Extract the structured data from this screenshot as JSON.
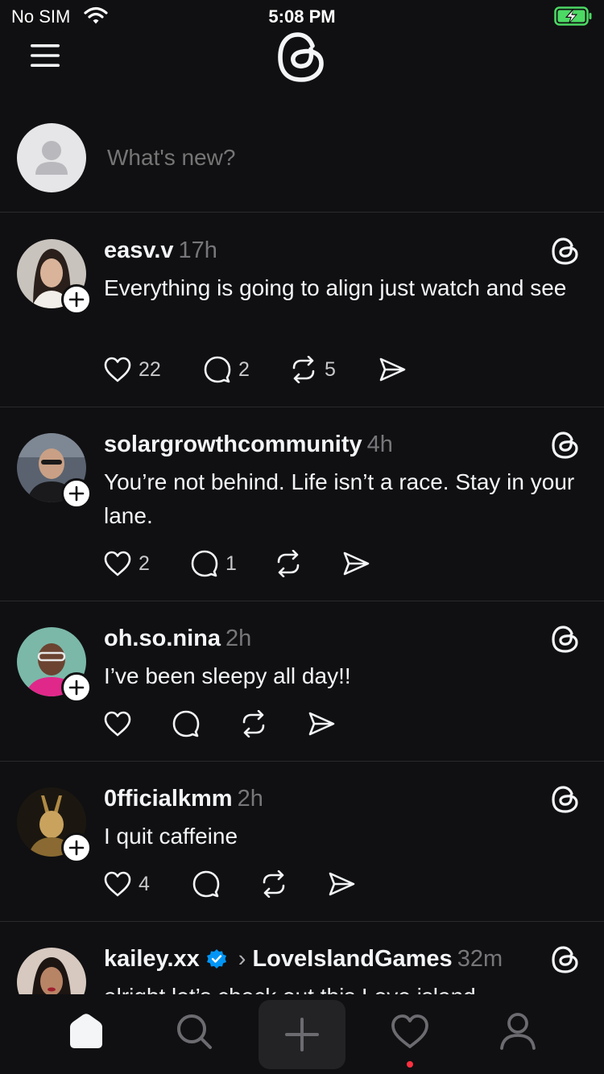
{
  "status_bar": {
    "carrier": "No SIM",
    "time": "5:08 PM"
  },
  "header": {
    "logo": "threads-logo",
    "menu_icon": "menu-icon"
  },
  "composer": {
    "placeholder": "What's new?"
  },
  "posts": [
    {
      "username": "easv.v",
      "time": "17h",
      "text": "Everything is going to align just watch and see",
      "likes": "22",
      "replies": "2",
      "reposts": "5",
      "verified": false
    },
    {
      "username": "solargrowthcommunity",
      "time": "4h",
      "text": "You’re not behind. Life isn’t a race. Stay in your lane.",
      "likes": "2",
      "replies": "1",
      "reposts": "",
      "verified": false
    },
    {
      "username": "oh.so.nina",
      "time": "2h",
      "text": "I’ve been sleepy all day!!",
      "likes": "",
      "replies": "",
      "reposts": "",
      "verified": false
    },
    {
      "username": "0fficialkmm",
      "time": "2h",
      "text": "I quit caffeine",
      "likes": "4",
      "replies": "",
      "reposts": "",
      "verified": false
    },
    {
      "username": "kailey.xx",
      "time": "32m",
      "text": "alright let’s check out this Love island",
      "community": "LoveIslandGames",
      "verified": true
    }
  ],
  "tabbar": {
    "items": [
      "home",
      "search",
      "compose",
      "activity",
      "profile"
    ]
  },
  "colors": {
    "background": "#101012",
    "text": "#f3f5f7",
    "muted": "#77777b",
    "verified": "#0095f6",
    "notification": "#ff3040"
  }
}
